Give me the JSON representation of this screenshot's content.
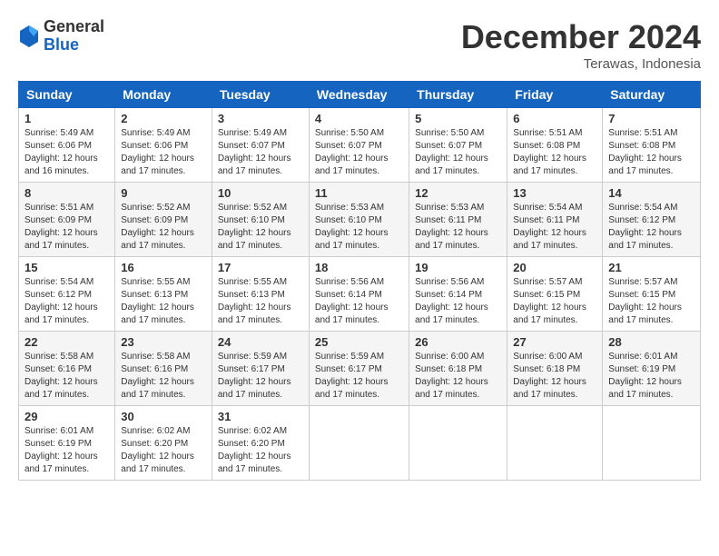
{
  "header": {
    "logo_general": "General",
    "logo_blue": "Blue",
    "month_title": "December 2024",
    "location": "Terawas, Indonesia"
  },
  "days_of_week": [
    "Sunday",
    "Monday",
    "Tuesday",
    "Wednesday",
    "Thursday",
    "Friday",
    "Saturday"
  ],
  "weeks": [
    [
      {
        "day": "1",
        "sunrise": "Sunrise: 5:49 AM",
        "sunset": "Sunset: 6:06 PM",
        "daylight": "Daylight: 12 hours and 16 minutes."
      },
      {
        "day": "2",
        "sunrise": "Sunrise: 5:49 AM",
        "sunset": "Sunset: 6:06 PM",
        "daylight": "Daylight: 12 hours and 17 minutes."
      },
      {
        "day": "3",
        "sunrise": "Sunrise: 5:49 AM",
        "sunset": "Sunset: 6:07 PM",
        "daylight": "Daylight: 12 hours and 17 minutes."
      },
      {
        "day": "4",
        "sunrise": "Sunrise: 5:50 AM",
        "sunset": "Sunset: 6:07 PM",
        "daylight": "Daylight: 12 hours and 17 minutes."
      },
      {
        "day": "5",
        "sunrise": "Sunrise: 5:50 AM",
        "sunset": "Sunset: 6:07 PM",
        "daylight": "Daylight: 12 hours and 17 minutes."
      },
      {
        "day": "6",
        "sunrise": "Sunrise: 5:51 AM",
        "sunset": "Sunset: 6:08 PM",
        "daylight": "Daylight: 12 hours and 17 minutes."
      },
      {
        "day": "7",
        "sunrise": "Sunrise: 5:51 AM",
        "sunset": "Sunset: 6:08 PM",
        "daylight": "Daylight: 12 hours and 17 minutes."
      }
    ],
    [
      {
        "day": "8",
        "sunrise": "Sunrise: 5:51 AM",
        "sunset": "Sunset: 6:09 PM",
        "daylight": "Daylight: 12 hours and 17 minutes."
      },
      {
        "day": "9",
        "sunrise": "Sunrise: 5:52 AM",
        "sunset": "Sunset: 6:09 PM",
        "daylight": "Daylight: 12 hours and 17 minutes."
      },
      {
        "day": "10",
        "sunrise": "Sunrise: 5:52 AM",
        "sunset": "Sunset: 6:10 PM",
        "daylight": "Daylight: 12 hours and 17 minutes."
      },
      {
        "day": "11",
        "sunrise": "Sunrise: 5:53 AM",
        "sunset": "Sunset: 6:10 PM",
        "daylight": "Daylight: 12 hours and 17 minutes."
      },
      {
        "day": "12",
        "sunrise": "Sunrise: 5:53 AM",
        "sunset": "Sunset: 6:11 PM",
        "daylight": "Daylight: 12 hours and 17 minutes."
      },
      {
        "day": "13",
        "sunrise": "Sunrise: 5:54 AM",
        "sunset": "Sunset: 6:11 PM",
        "daylight": "Daylight: 12 hours and 17 minutes."
      },
      {
        "day": "14",
        "sunrise": "Sunrise: 5:54 AM",
        "sunset": "Sunset: 6:12 PM",
        "daylight": "Daylight: 12 hours and 17 minutes."
      }
    ],
    [
      {
        "day": "15",
        "sunrise": "Sunrise: 5:54 AM",
        "sunset": "Sunset: 6:12 PM",
        "daylight": "Daylight: 12 hours and 17 minutes."
      },
      {
        "day": "16",
        "sunrise": "Sunrise: 5:55 AM",
        "sunset": "Sunset: 6:13 PM",
        "daylight": "Daylight: 12 hours and 17 minutes."
      },
      {
        "day": "17",
        "sunrise": "Sunrise: 5:55 AM",
        "sunset": "Sunset: 6:13 PM",
        "daylight": "Daylight: 12 hours and 17 minutes."
      },
      {
        "day": "18",
        "sunrise": "Sunrise: 5:56 AM",
        "sunset": "Sunset: 6:14 PM",
        "daylight": "Daylight: 12 hours and 17 minutes."
      },
      {
        "day": "19",
        "sunrise": "Sunrise: 5:56 AM",
        "sunset": "Sunset: 6:14 PM",
        "daylight": "Daylight: 12 hours and 17 minutes."
      },
      {
        "day": "20",
        "sunrise": "Sunrise: 5:57 AM",
        "sunset": "Sunset: 6:15 PM",
        "daylight": "Daylight: 12 hours and 17 minutes."
      },
      {
        "day": "21",
        "sunrise": "Sunrise: 5:57 AM",
        "sunset": "Sunset: 6:15 PM",
        "daylight": "Daylight: 12 hours and 17 minutes."
      }
    ],
    [
      {
        "day": "22",
        "sunrise": "Sunrise: 5:58 AM",
        "sunset": "Sunset: 6:16 PM",
        "daylight": "Daylight: 12 hours and 17 minutes."
      },
      {
        "day": "23",
        "sunrise": "Sunrise: 5:58 AM",
        "sunset": "Sunset: 6:16 PM",
        "daylight": "Daylight: 12 hours and 17 minutes."
      },
      {
        "day": "24",
        "sunrise": "Sunrise: 5:59 AM",
        "sunset": "Sunset: 6:17 PM",
        "daylight": "Daylight: 12 hours and 17 minutes."
      },
      {
        "day": "25",
        "sunrise": "Sunrise: 5:59 AM",
        "sunset": "Sunset: 6:17 PM",
        "daylight": "Daylight: 12 hours and 17 minutes."
      },
      {
        "day": "26",
        "sunrise": "Sunrise: 6:00 AM",
        "sunset": "Sunset: 6:18 PM",
        "daylight": "Daylight: 12 hours and 17 minutes."
      },
      {
        "day": "27",
        "sunrise": "Sunrise: 6:00 AM",
        "sunset": "Sunset: 6:18 PM",
        "daylight": "Daylight: 12 hours and 17 minutes."
      },
      {
        "day": "28",
        "sunrise": "Sunrise: 6:01 AM",
        "sunset": "Sunset: 6:19 PM",
        "daylight": "Daylight: 12 hours and 17 minutes."
      }
    ],
    [
      {
        "day": "29",
        "sunrise": "Sunrise: 6:01 AM",
        "sunset": "Sunset: 6:19 PM",
        "daylight": "Daylight: 12 hours and 17 minutes."
      },
      {
        "day": "30",
        "sunrise": "Sunrise: 6:02 AM",
        "sunset": "Sunset: 6:20 PM",
        "daylight": "Daylight: 12 hours and 17 minutes."
      },
      {
        "day": "31",
        "sunrise": "Sunrise: 6:02 AM",
        "sunset": "Sunset: 6:20 PM",
        "daylight": "Daylight: 12 hours and 17 minutes."
      },
      null,
      null,
      null,
      null
    ]
  ]
}
